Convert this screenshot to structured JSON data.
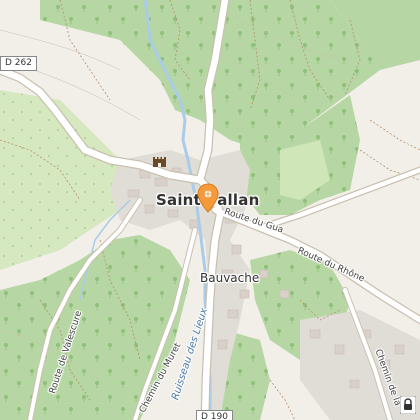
{
  "map": {
    "town": "Saint-Vallan",
    "village": "Bauvache",
    "roads": {
      "d262": "D 262",
      "d190": "D 190",
      "route_du_gua": "Route du Gua",
      "route_du_rhone": "Route du Rhône",
      "route_de_valescure": "Route de Valescure",
      "chemin_du_muret": "Chemin du Muret",
      "chemin_de_la": "Chemin de la"
    },
    "water": {
      "ruisseau": "Ruisseau des Lieux"
    },
    "colors": {
      "background": "#f2efe9",
      "forest": "#b6d7a3",
      "grass": "#d6e8c0",
      "water": "#a9cce8",
      "road": "#ffffff",
      "road_outline": "#c9c0b0",
      "marker": "#f59a3a",
      "building": "#d9d0c9"
    },
    "icons": [
      "location-pin-icon",
      "castle-icon",
      "lock-icon"
    ]
  }
}
